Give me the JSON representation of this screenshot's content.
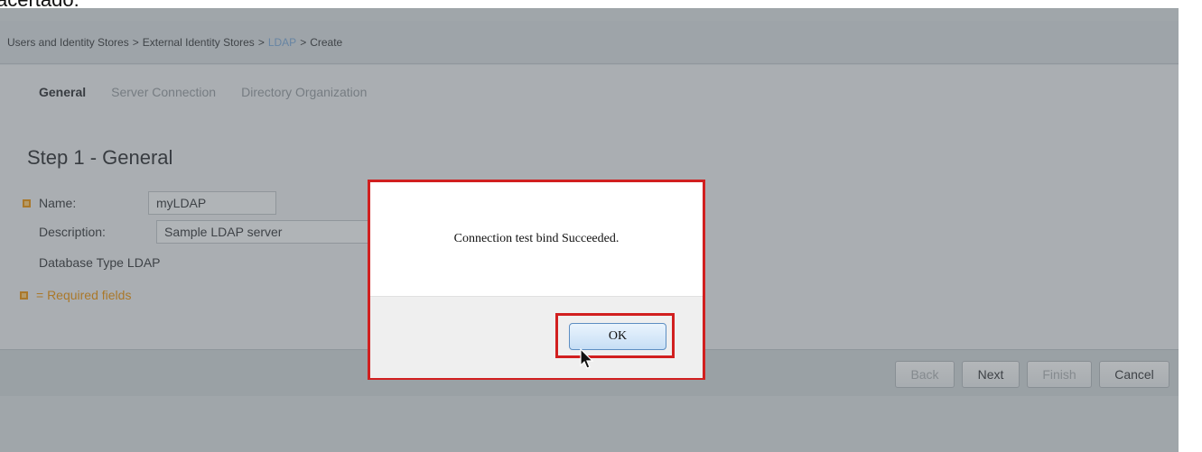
{
  "caption_fragment": "acertado:",
  "breadcrumb": {
    "items": [
      "Users and Identity Stores",
      "External Identity Stores",
      "LDAP",
      "Create"
    ],
    "separator": ">"
  },
  "tabs": [
    {
      "label": "General",
      "active": true
    },
    {
      "label": "Server Connection",
      "active": false
    },
    {
      "label": "Directory Organization",
      "active": false
    }
  ],
  "step_title": "Step 1 - General",
  "form": {
    "name_label": "Name:",
    "name_value": "myLDAP",
    "description_label": "Description:",
    "description_value": "Sample LDAP server",
    "database_type_label": "Database Type",
    "database_type_value": "LDAP",
    "required_note": "= Required fields"
  },
  "footer_buttons": {
    "back": "Back",
    "next": "Next",
    "finish": "Finish",
    "cancel": "Cancel"
  },
  "dialog": {
    "message": "Connection test bind Succeeded.",
    "ok_label": "OK"
  },
  "colors": {
    "highlight_border": "#d11f1f",
    "required_accent": "#e48a00",
    "link": "#6f9fd0"
  },
  "icons": [
    "required-field-icon",
    "mouse-pointer-icon"
  ]
}
